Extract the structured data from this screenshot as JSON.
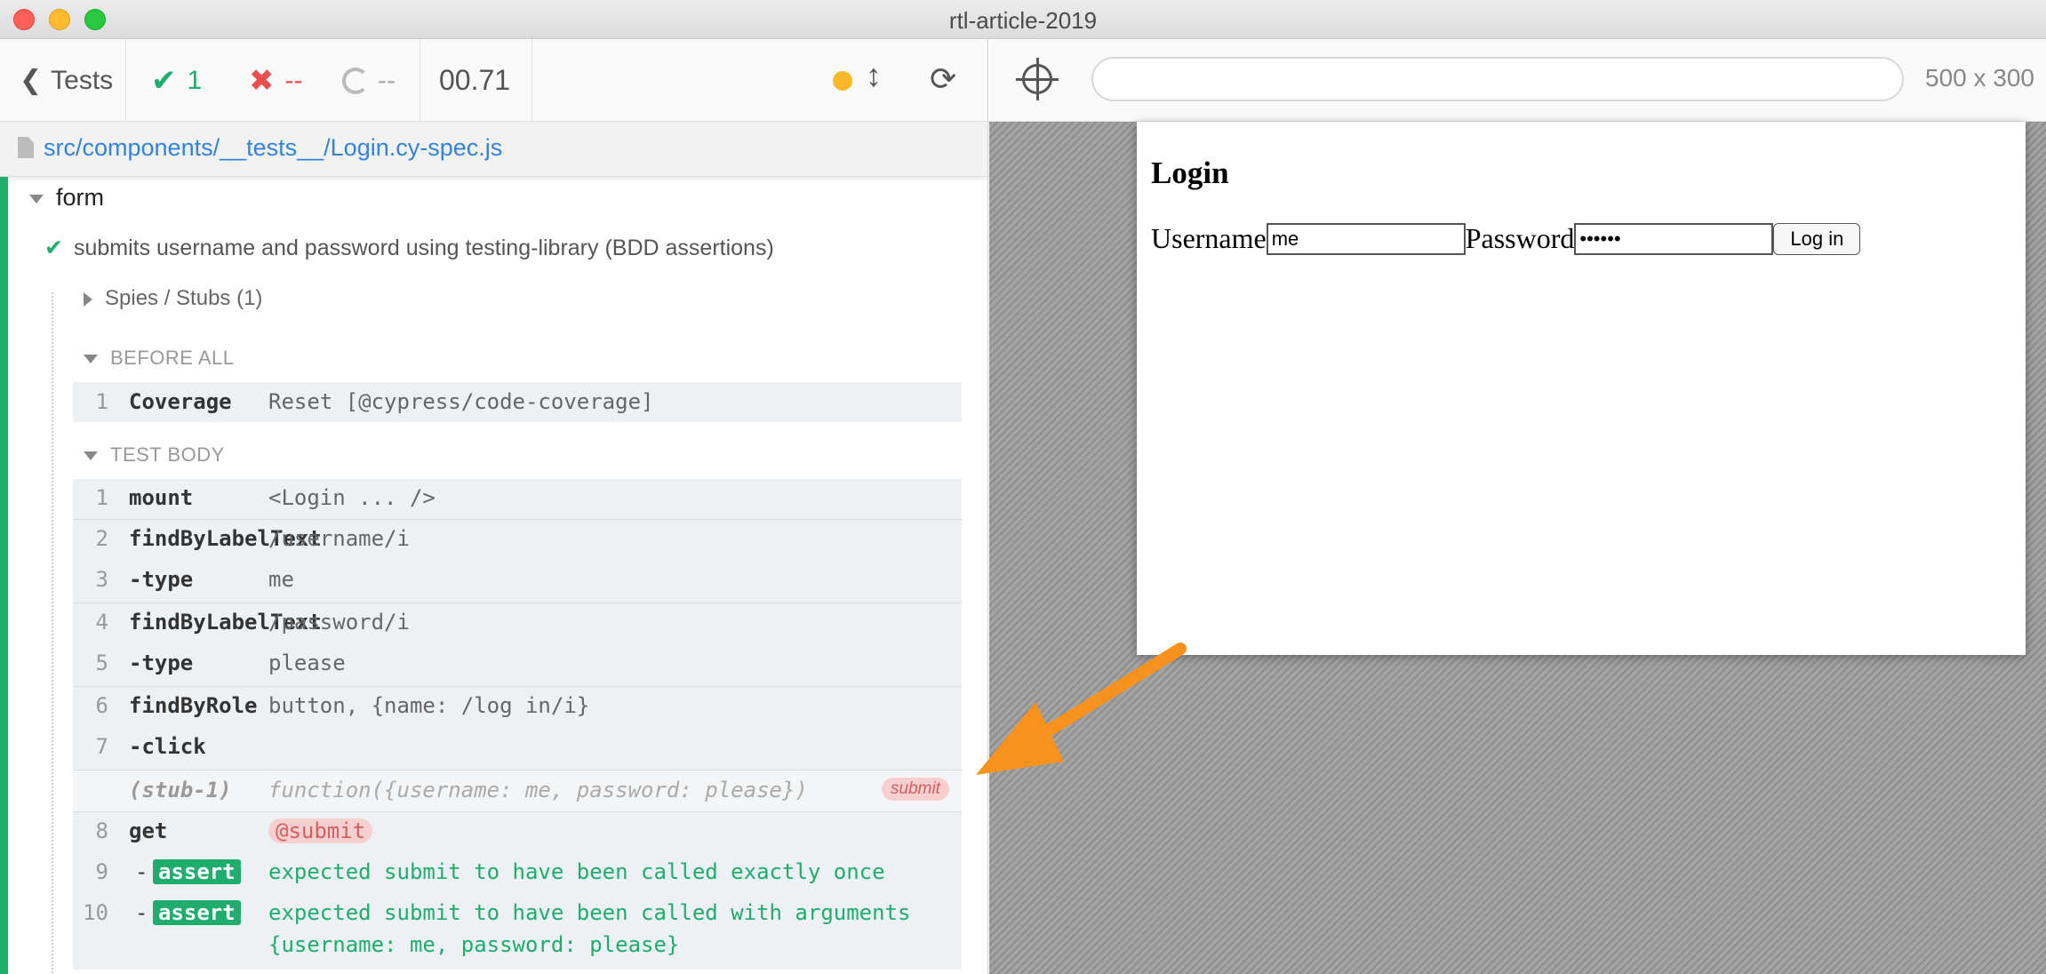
{
  "window": {
    "title": "rtl-article-2019"
  },
  "reporter": {
    "back_label": "Tests",
    "passed_count": "1",
    "failed_count": "--",
    "pending_count": "--",
    "duration": "00.71",
    "spec_path": "src/components/__tests__/Login.cy-spec.js",
    "suite_title": "form",
    "test_title": "submits username and password using testing-library (BDD assertions)",
    "spies_label": "Spies / Stubs (1)",
    "before_all_label": "BEFORE ALL",
    "test_body_label": "TEST BODY",
    "before_all_commands": [
      {
        "num": "1",
        "name": "Coverage",
        "message": "Reset [@cypress/code-coverage]"
      }
    ],
    "commands": [
      {
        "num": "1",
        "name": "mount",
        "message": "<Login ... />"
      },
      {
        "num": "2",
        "name": "findByLabelText",
        "message": "/username/i"
      },
      {
        "num": "3",
        "name": "-type",
        "message": "me"
      },
      {
        "num": "4",
        "name": "findByLabelText",
        "message": "/password/i"
      },
      {
        "num": "5",
        "name": "-type",
        "message": "please"
      },
      {
        "num": "6",
        "name": "findByRole",
        "message": "button, {name: /log in/i}"
      },
      {
        "num": "7",
        "name": "-click",
        "message": ""
      }
    ],
    "stub_call": {
      "name": "(stub-1)",
      "message": "function({username: me, password: please})",
      "alias": "submit"
    },
    "get_command": {
      "num": "8",
      "name": "get",
      "alias": "@submit"
    },
    "asserts": [
      {
        "num": "9",
        "dash": "-",
        "badge": "assert",
        "message": "expected submit to have been called exactly once"
      },
      {
        "num": "10",
        "dash": "-",
        "badge": "assert",
        "message": "expected submit to have been called with arguments",
        "message2": "{username: me, password: please}"
      }
    ]
  },
  "aut": {
    "url": "",
    "viewport": "500 x 300",
    "heading": "Login",
    "username_label": "Username",
    "username_value": "me",
    "password_label": "Password",
    "password_value": "••••••",
    "login_button": "Log in"
  },
  "colors": {
    "passed": "#1fad6e",
    "failed": "#e94f4f",
    "link": "#3383de",
    "arrow": "#f7921e",
    "alias_bg": "#f6cfcf"
  }
}
